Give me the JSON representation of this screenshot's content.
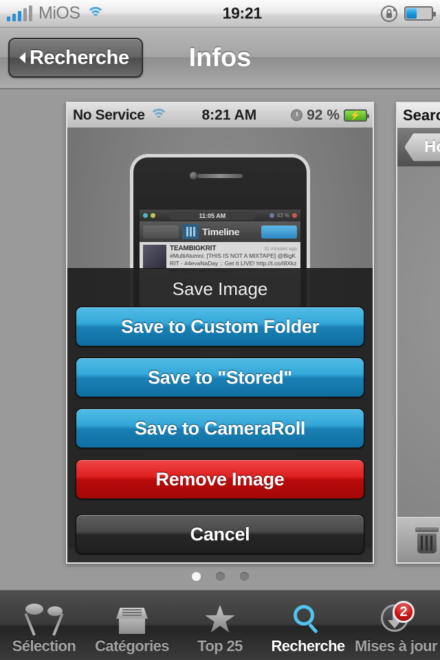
{
  "status_bar": {
    "carrier": "MiOS",
    "time": "19:21",
    "signal_icon": "signal-bars-icon",
    "wifi_icon": "wifi-icon",
    "rotation_lock_icon": "rotation-lock-icon",
    "battery_icon": "battery-icon"
  },
  "nav_bar": {
    "back_label": "Recherche",
    "title": "Infos"
  },
  "screenshot_main": {
    "status": {
      "carrier": "No Service",
      "time": "8:21 AM",
      "battery_pct": "92 %",
      "wifi_icon": "wifi-icon",
      "alarm_icon": "alarm-clock-icon",
      "battery_icon": "battery-charging-icon"
    },
    "phone_screen": {
      "time": "11:05 AM",
      "battery_pct": "43 %",
      "nav_title": "Timeline",
      "tweet": {
        "user": "TEAMBIGKRIT",
        "ago": "31 minutes ago",
        "text": "#MultiAlumni: [THIS IS NOT A MIXTAPE] @BigKRIT - #4evaNaDay :: Get It LIVE! http://t.co/I8Xkz6bh http://t.co/XSWisfob"
      }
    },
    "action_sheet": {
      "title": "Save Image",
      "buttons": [
        {
          "label": "Save to Custom Folder",
          "style": "blue"
        },
        {
          "label": "Save to \"Stored\"",
          "style": "blue"
        },
        {
          "label": "Save to CameraRoll",
          "style": "blue"
        },
        {
          "label": "Remove Image",
          "style": "red"
        },
        {
          "label": "Cancel",
          "style": "dark"
        }
      ]
    }
  },
  "screenshot_next": {
    "status_text": "Search...",
    "home_button": "Home",
    "trash_icon": "trash-icon"
  },
  "page_dots": {
    "count": 3,
    "active_index": 0
  },
  "tab_bar": {
    "items": [
      {
        "label": "Sélection",
        "icon": "spotlights-icon",
        "active": false,
        "badge": ""
      },
      {
        "label": "Catégories",
        "icon": "card-file-icon",
        "active": false,
        "badge": ""
      },
      {
        "label": "Top 25",
        "icon": "star-icon",
        "active": false,
        "badge": ""
      },
      {
        "label": "Recherche",
        "icon": "magnifier-icon",
        "active": true,
        "badge": ""
      },
      {
        "label": "Mises à jour",
        "icon": "download-arrow-icon",
        "active": false,
        "badge": "2"
      }
    ]
  },
  "colors": {
    "accent_blue": "#33a6d8",
    "danger_red": "#e02020",
    "badge_red": "#d01515",
    "search_cyan": "#53c3ef"
  }
}
